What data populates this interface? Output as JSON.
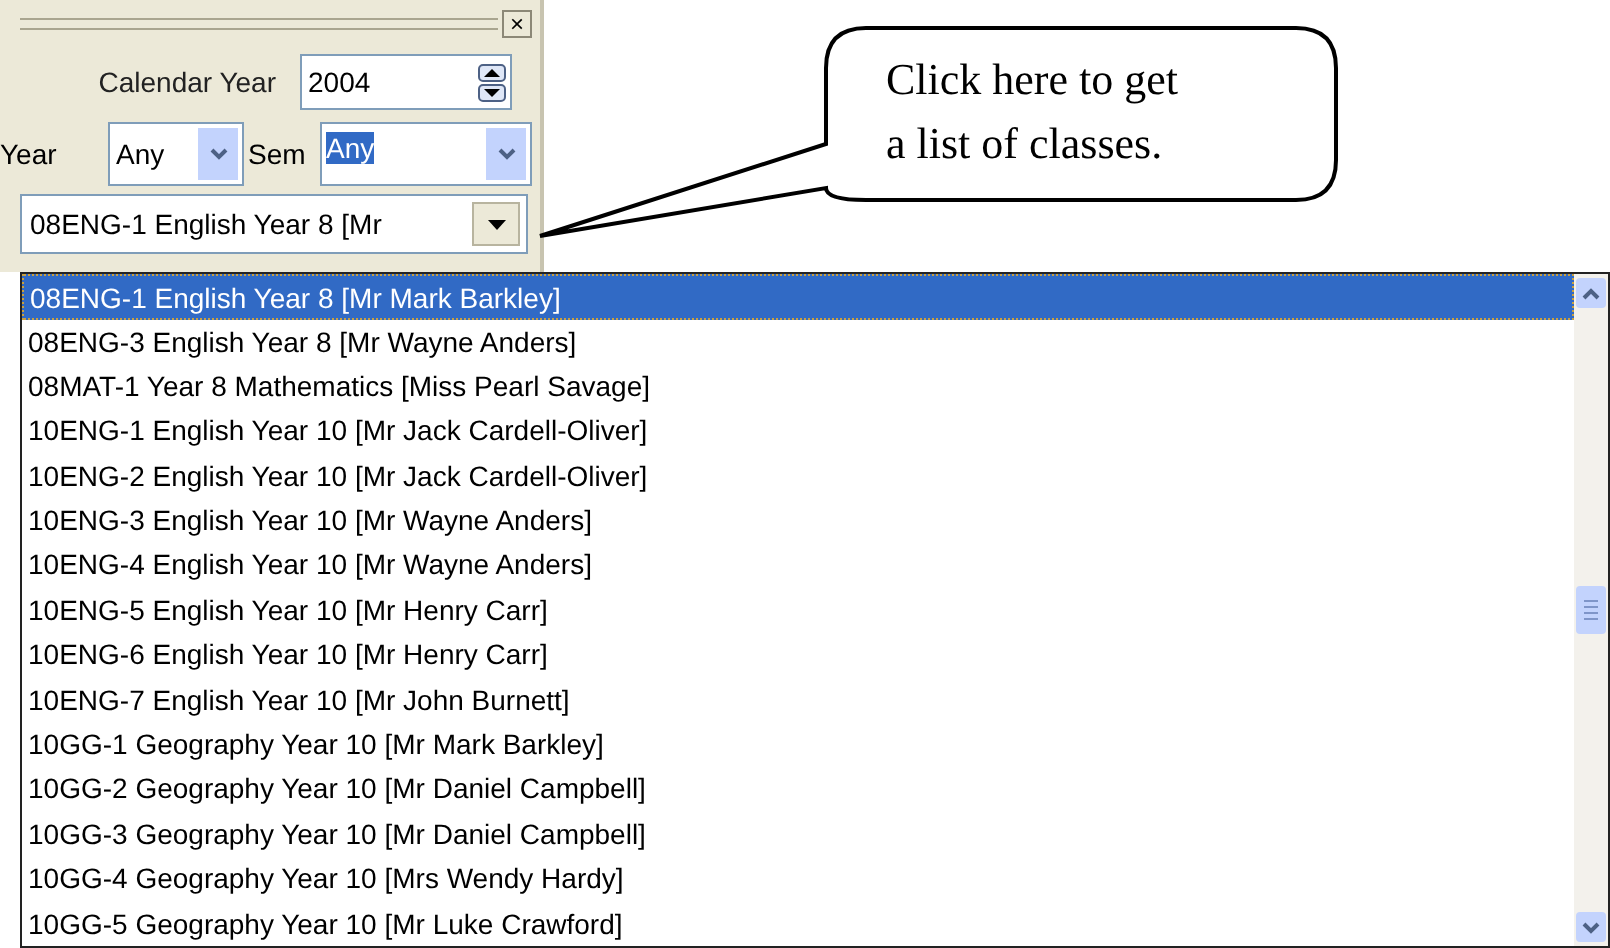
{
  "panel": {
    "close_button": "×",
    "calendar_year": {
      "label": "Calendar Year",
      "value": "2004"
    },
    "year": {
      "label": "Year",
      "value": "Any"
    },
    "sem": {
      "label": "Sem",
      "value": "Any",
      "highlighted": true
    },
    "class_combo": {
      "value": "08ENG-1 English Year 8 [Mr"
    }
  },
  "callout": {
    "lines": [
      "Click here to get",
      "a list of classes."
    ]
  },
  "class_list": {
    "items": [
      {
        "label": "08ENG-1 English Year 8 [Mr Mark Barkley]",
        "selected": true
      },
      {
        "label": "08ENG-3 English Year 8 [Mr Wayne Anders]",
        "selected": false
      },
      {
        "label": "08MAT-1 Year 8 Mathematics [Miss Pearl Savage]",
        "selected": false
      },
      {
        "label": "10ENG-1 English Year 10 [Mr Jack Cardell-Oliver]",
        "selected": false
      },
      {
        "label": "10ENG-2 English Year 10 [Mr Jack Cardell-Oliver]",
        "selected": false
      },
      {
        "label": "10ENG-3 English Year 10 [Mr Wayne Anders]",
        "selected": false
      },
      {
        "label": "10ENG-4 English Year 10 [Mr Wayne Anders]",
        "selected": false
      },
      {
        "label": "10ENG-5 English Year 10 [Mr Henry Carr]",
        "selected": false
      },
      {
        "label": "10ENG-6 English Year 10 [Mr Henry Carr]",
        "selected": false
      },
      {
        "label": "10ENG-7 English Year 10 [Mr John Burnett]",
        "selected": false
      },
      {
        "label": "10GG-1 Geography Year 10 [Mr Mark Barkley]",
        "selected": false
      },
      {
        "label": "10GG-2 Geography Year 10 [Mr Daniel Campbell]",
        "selected": false
      },
      {
        "label": "10GG-3 Geography Year 10 [Mr Daniel Campbell]",
        "selected": false
      },
      {
        "label": "10GG-4 Geography Year 10 [Mrs Wendy Hardy]",
        "selected": false
      },
      {
        "label": "10GG-5 Geography Year 10 [Mr Luke Crawford]",
        "selected": false
      }
    ]
  }
}
